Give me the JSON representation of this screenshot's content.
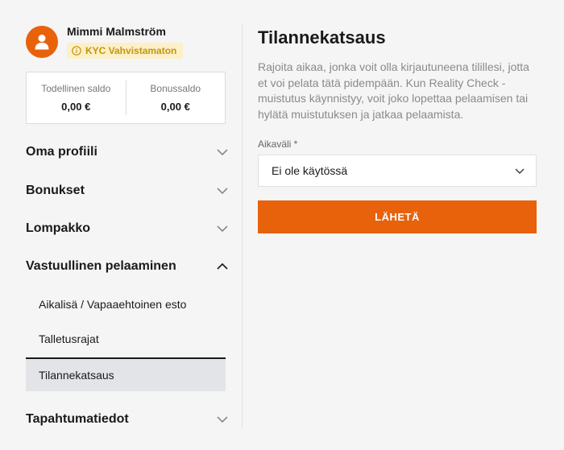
{
  "user": {
    "name": "Mimmi Malmström",
    "kyc_badge": "KYC Vahvistamaton"
  },
  "balances": {
    "real_label": "Todellinen saldo",
    "real_value": "0,00 €",
    "bonus_label": "Bonussaldo",
    "bonus_value": "0,00 €"
  },
  "menu": {
    "profile": "Oma profiili",
    "bonuses": "Bonukset",
    "wallet": "Lompakko",
    "responsible": "Vastuullinen pelaaminen",
    "responsible_items": [
      "Aikalisä / Vapaaehtoinen esto",
      "Talletusrajat",
      "Tilannekatsaus"
    ],
    "events": "Tapahtumatiedot"
  },
  "main": {
    "title": "Tilannekatsaus",
    "description": "Rajoita aikaa, jonka voit olla kirjautuneena tilillesi, jotta et voi pelata tätä pidempään. Kun Reality Check -muistutus käynnistyy, voit joko lopettaa pelaamisen tai hylätä muistutuksen ja jatkaa pelaamista.",
    "field_label": "Aikaväli *",
    "select_value": "Ei ole käytössä",
    "submit_label": "LÄHETÄ"
  },
  "colors": {
    "accent": "#e8620c",
    "badge_bg": "#fcf0c8",
    "badge_text": "#c79410",
    "active_bg": "#e3e4e8"
  },
  "icons": {
    "avatar": "user-icon",
    "badge": "info-circle-icon",
    "collapsed": "chevron-down-icon",
    "expanded": "chevron-up-icon"
  }
}
